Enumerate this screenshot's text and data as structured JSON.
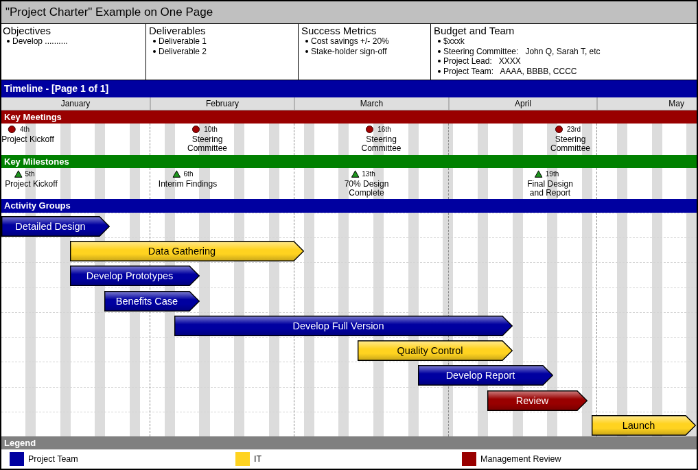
{
  "title": "\"Project Charter\" Example on One Page",
  "charter": [
    {
      "heading": "Objectives",
      "items": [
        "Develop .........."
      ]
    },
    {
      "heading": "Deliverables",
      "items": [
        "Deliverable 1",
        "Deliverable 2"
      ]
    },
    {
      "heading": "Success Metrics",
      "items": [
        "Cost savings +/- 20%",
        "Stake-holder sign-off"
      ]
    },
    {
      "heading": "Budget and Team",
      "items": [
        "$xxxk",
        "Steering Committee:   John Q, Sarah T, etc",
        "Project Lead:   XXXX",
        "Project Team:   AAAA, BBBB, CCCC"
      ]
    }
  ],
  "timeline": {
    "title": "Timeline - [Page 1 of 1]",
    "months": [
      "January",
      "February",
      "March",
      "April",
      "May"
    ]
  },
  "meetings": {
    "title": "Key Meetings",
    "items": [
      {
        "day": "4th",
        "label": "Project Kickoff"
      },
      {
        "day": "10th",
        "label": "Steering\nCommittee"
      },
      {
        "day": "16th",
        "label": "Steering\nCommittee"
      },
      {
        "day": "23rd",
        "label": "Steering\nCommittee"
      }
    ]
  },
  "milestones": {
    "title": "Key Milestones",
    "items": [
      {
        "day": "5th",
        "label": "Project Kickoff"
      },
      {
        "day": "6th",
        "label": "Interim Findings"
      },
      {
        "day": "13th",
        "label": "70% Design\nComplete"
      },
      {
        "day": "19th",
        "label": "Final Design\nand Report"
      }
    ]
  },
  "activities": {
    "title": "Activity Groups",
    "items": [
      {
        "label": "Detailed Design",
        "color": "#0000a0"
      },
      {
        "label": "Data Gathering",
        "color": "#ffd320"
      },
      {
        "label": "Develop Prototypes",
        "color": "#0000a0"
      },
      {
        "label": "Benefits Case",
        "color": "#0000a0"
      },
      {
        "label": "Develop Full Version",
        "color": "#0000a0"
      },
      {
        "label": "Quality Control",
        "color": "#ffd320"
      },
      {
        "label": "Develop Report",
        "color": "#0000a0"
      },
      {
        "label": "Review",
        "color": "#990000"
      },
      {
        "label": "Launch",
        "color": "#ffd320"
      }
    ]
  },
  "legend": {
    "title": "Legend",
    "items": [
      {
        "label": "Project Team",
        "color": "#0000a0"
      },
      {
        "label": "IT",
        "color": "#ffd320"
      },
      {
        "label": "Management Review",
        "color": "#990000"
      }
    ]
  }
}
